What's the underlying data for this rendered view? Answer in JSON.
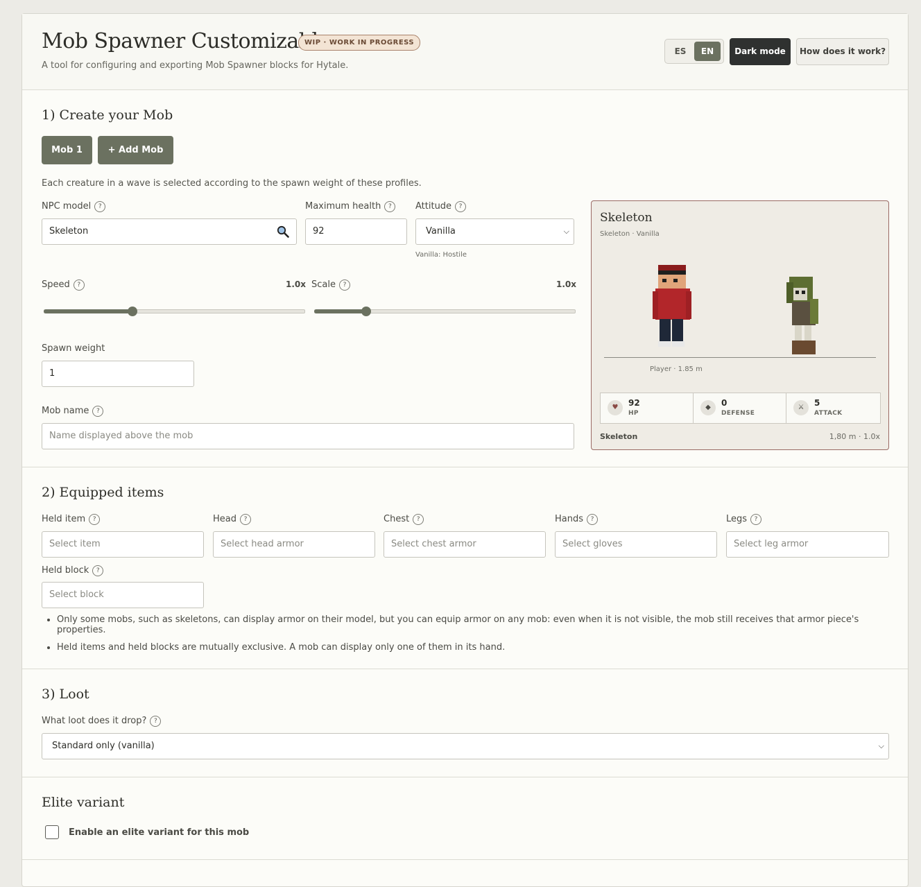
{
  "header": {
    "title": "Mob Spawner Customizable",
    "badge": "WIP · WORK IN PROGRESS",
    "subtitle": "A tool for configuring and exporting Mob Spawner blocks for Hytale.",
    "lang_es": "ES",
    "lang_en": "EN",
    "dark_mode": "Dark mode",
    "how": "How does it work?"
  },
  "section1": {
    "title": "1) Create your Mob",
    "tab_mob1": "Mob 1",
    "add_mob": "+ Add Mob",
    "help": "Each creature in a wave is selected according to the spawn weight of these profiles.",
    "npc_label": "NPC model",
    "npc_value": "Skeleton",
    "health_label": "Maximum health",
    "health_value": "92",
    "attitude_label": "Attitude",
    "attitude_value": "Vanilla",
    "attitude_hint": "Vanilla: Hostile",
    "speed_label": "Speed",
    "speed_value": "1.0x",
    "speed_level": 0.34,
    "scale_label": "Scale",
    "scale_value": "1.0x",
    "scale_level": 0.2,
    "weight_label": "Spawn weight",
    "weight_value": "1",
    "name_label": "Mob name",
    "name_placeholder": "Name displayed above the mob"
  },
  "preview": {
    "name": "Skeleton",
    "sub": "Skeleton · Vanilla",
    "player_label": "Player · 1.85 m",
    "hp_value": "92",
    "hp_label": "HP",
    "def_value": "0",
    "def_label": "DEFENSE",
    "atk_value": "5",
    "atk_label": "ATTACK",
    "foot_left": "Skeleton",
    "foot_right": "1,80 m · 1.0x"
  },
  "section2": {
    "title": "2) Equipped items",
    "held_item_label": "Held item",
    "held_item_ph": "Select item",
    "head_label": "Head",
    "head_ph": "Select head armor",
    "chest_label": "Chest",
    "chest_ph": "Select chest armor",
    "hands_label": "Hands",
    "hands_ph": "Select gloves",
    "legs_label": "Legs",
    "legs_ph": "Select leg armor",
    "block_label": "Held block",
    "block_ph": "Select block",
    "note1": "Only some mobs, such as skeletons, can display armor on their model, but you can equip armor on any mob: even when it is not visible, the mob still receives that armor piece's properties.",
    "note2": "Held items and held blocks are mutually exclusive. A mob can display only one of them in its hand."
  },
  "section3": {
    "title": "3) Loot",
    "loot_label": "What loot does it drop?",
    "loot_value": "Standard only (vanilla)"
  },
  "elite": {
    "title": "Elite variant",
    "checkbox_label": "Enable an elite variant for this mob"
  }
}
